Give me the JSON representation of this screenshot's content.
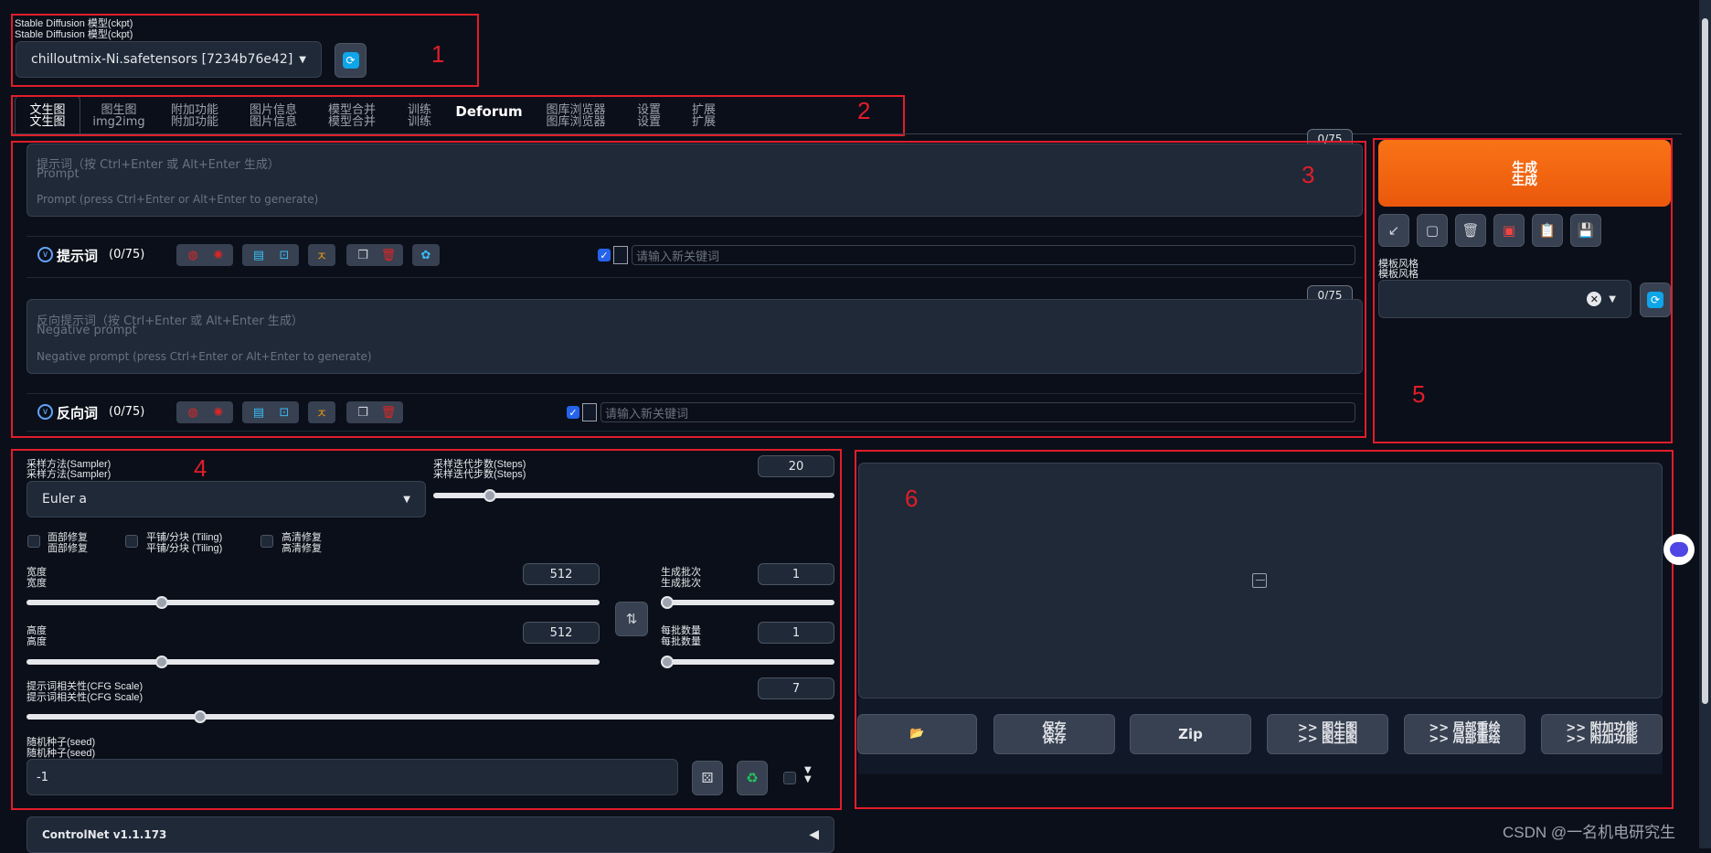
{
  "model": {
    "label": "Stable Diffusion 模型(ckpt)",
    "label_dup": "Stable Diffusion 模型(ckpt)",
    "value": "chilloutmix-Ni.safetensors [7234b76e42]",
    "refresh_icon": "refresh-icon"
  },
  "tabs": [
    {
      "l1": "文生图",
      "l2": "文生图"
    },
    {
      "l1": "图生图",
      "l2": "img2img"
    },
    {
      "l1": "附加功能",
      "l2": "附加功能"
    },
    {
      "l1": "图片信息",
      "l2": "图片信息"
    },
    {
      "l1": "模型合并",
      "l2": "模型合并"
    },
    {
      "l1": "训练",
      "l2": "训练"
    },
    {
      "l1": "Deforum",
      "l2": ""
    },
    {
      "l1": "图库浏览器",
      "l2": "图库浏览器"
    },
    {
      "l1": "设置",
      "l2": "设置"
    },
    {
      "l1": "扩展",
      "l2": "扩展"
    }
  ],
  "prompt": {
    "counter": "0/75",
    "placeholder_cn": "提示词（按 Ctrl+Enter 或 Alt+Enter 生成）",
    "placeholder_en1": "Prompt",
    "placeholder_en2": "Prompt (press Ctrl+Enter or Alt+Enter to generate)",
    "toolbar_label": "提示词",
    "toolbar_count": "(0/75)",
    "keyword_placeholder": "请输入新关键词"
  },
  "negative": {
    "counter": "0/75",
    "placeholder_cn": "反向提示词（按 Ctrl+Enter 或 Alt+Enter 生成）",
    "placeholder_en1": "Negative prompt",
    "placeholder_en2": "Negative prompt (press Ctrl+Enter or Alt+Enter to generate)",
    "toolbar_label": "反向词",
    "toolbar_count": "(0/75)",
    "keyword_placeholder": "请输入新关键词"
  },
  "generate": {
    "l1": "生成",
    "l2": "生成"
  },
  "style": {
    "label1": "模板风格",
    "label2": "模板风格"
  },
  "sampler": {
    "label1": "采样方法(Sampler)",
    "label2": "采样方法(Sampler)",
    "value": "Euler a",
    "steps_label1": "采样迭代步数(Steps)",
    "steps_label2": "采样迭代步数(Steps)",
    "steps": "20",
    "steps_fraction": 0.13
  },
  "checks": [
    {
      "l1": "面部修复",
      "l2": "面部修复"
    },
    {
      "l1": "平铺/分块 (Tiling)",
      "l2": "平铺/分块 (Tiling)"
    },
    {
      "l1": "高清修复",
      "l2": "高清修复"
    }
  ],
  "width": {
    "l1": "宽度",
    "l2": "宽度",
    "value": "512",
    "fraction": 0.23
  },
  "height": {
    "l1": "高度",
    "l2": "高度",
    "value": "512",
    "fraction": 0.23
  },
  "batch_count": {
    "l1": "生成批次",
    "l2": "生成批次",
    "value": "1",
    "fraction": 0.0
  },
  "batch_size": {
    "l1": "每批数量",
    "l2": "每批数量",
    "value": "1",
    "fraction": 0.0
  },
  "cfg": {
    "l1": "提示词相关性(CFG Scale)",
    "l2": "提示词相关性(CFG Scale)",
    "value": "7",
    "fraction": 0.21
  },
  "seed": {
    "l1": "随机种子(seed)",
    "l2": "随机种子(seed)",
    "value": "-1"
  },
  "controlnet": {
    "label": "ControlNet v1.1.173"
  },
  "output_buttons": [
    {
      "l1": "",
      "l2": ""
    },
    {
      "l1": "保存",
      "l2": "保存"
    },
    {
      "l1": "Zip",
      "l2": ""
    },
    {
      "l1": ">> 图生图",
      "l2": ">> 图生图"
    },
    {
      "l1": ">> 局部重绘",
      "l2": ">> 局部重绘"
    },
    {
      "l1": ">> 附加功能",
      "l2": ">> 附加功能"
    }
  ],
  "annotations": [
    "1",
    "2",
    "3",
    "4",
    "5",
    "6"
  ],
  "watermark": "CSDN @一名机电研究生",
  "colors": {
    "accent": "#f97316",
    "annotation": "#e11d2a",
    "bg": "#0b0f19",
    "panel": "#1f2937"
  }
}
